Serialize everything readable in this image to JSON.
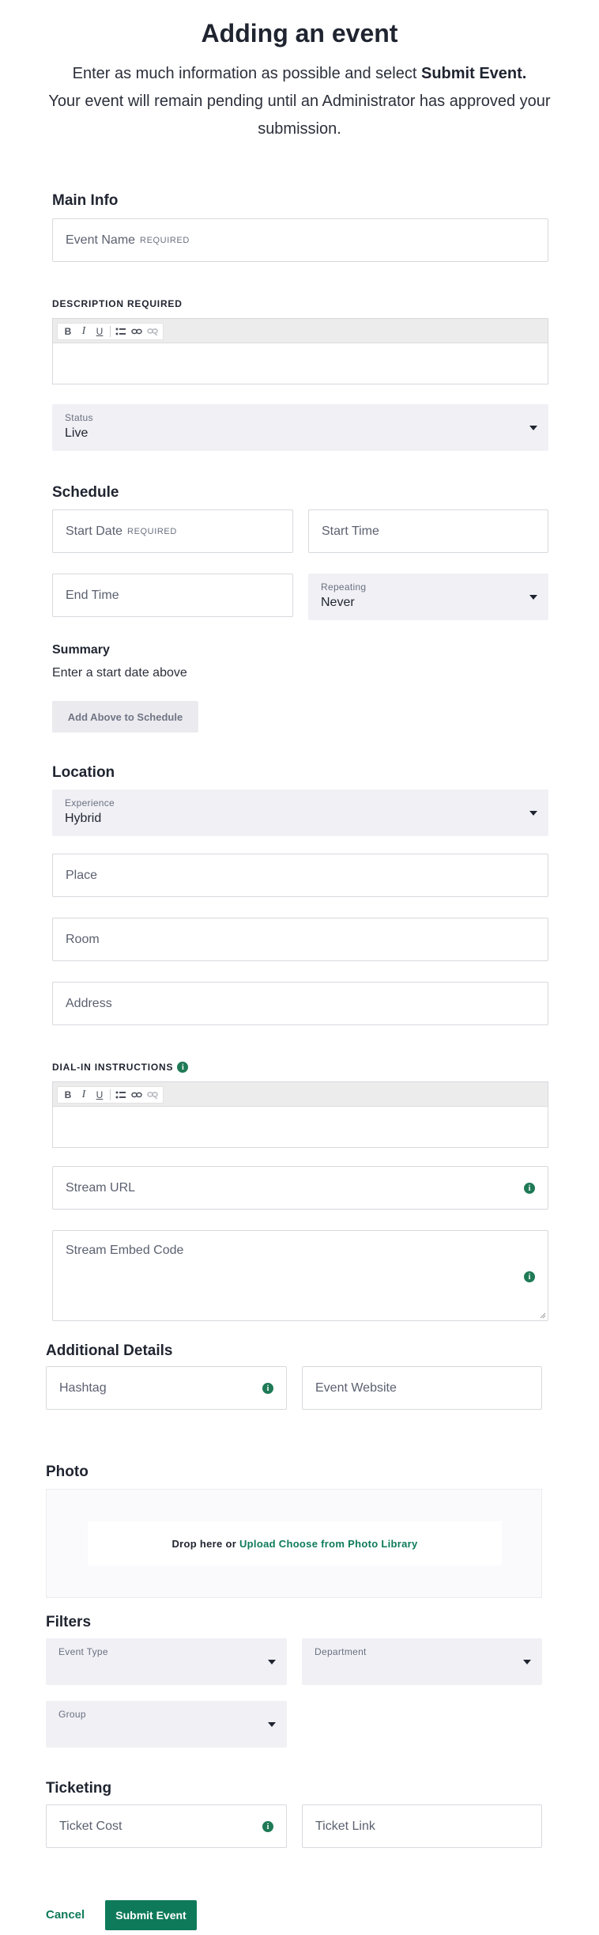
{
  "header": {
    "title": "Adding an event",
    "intro_pre": "Enter as much information as possible and select",
    "intro_bold": "Submit Event.",
    "intro_rest": "Your event will remain pending until an Administrator has approved your submission."
  },
  "main_info": {
    "heading": "Main Info",
    "event_name_placeholder": "Event Name",
    "required": "REQUIRED",
    "description_label": "DESCRIPTION REQUIRED",
    "status_label": "Status",
    "status_value": "Live"
  },
  "editor_tools": {
    "bold": "B",
    "italic": "I",
    "underline": "U",
    "list": "list-icon",
    "link": "link-icon",
    "unlink": "unlink-icon"
  },
  "schedule": {
    "heading": "Schedule",
    "start_date": "Start Date",
    "start_time": "Start Time",
    "end_time": "End Time",
    "repeating_label": "Repeating",
    "repeating_value": "Never",
    "summary_heading": "Summary",
    "summary_text": "Enter a start date above",
    "add_button": "Add Above to Schedule"
  },
  "location": {
    "heading": "Location",
    "experience_label": "Experience",
    "experience_value": "Hybrid",
    "place": "Place",
    "room": "Room",
    "address": "Address",
    "dial_in_label": "DIAL-IN INSTRUCTIONS",
    "stream_url": "Stream URL",
    "stream_embed": "Stream Embed Code"
  },
  "additional": {
    "heading": "Additional Details",
    "hashtag": "Hashtag",
    "website": "Event Website"
  },
  "photo": {
    "heading": "Photo",
    "drop_text": "Drop  here or",
    "upload": "Upload",
    "choose": "Choose from Photo Library"
  },
  "filters": {
    "heading": "Filters",
    "event_type": "Event Type",
    "department": "Department",
    "group": "Group"
  },
  "ticketing": {
    "heading": "Ticketing",
    "ticket_cost": "Ticket Cost",
    "ticket_link": "Ticket Link"
  },
  "actions": {
    "cancel": "Cancel",
    "submit": "Submit Event"
  },
  "colors": {
    "accent": "#0e7a5a",
    "select_bg": "#f0f0f5"
  }
}
